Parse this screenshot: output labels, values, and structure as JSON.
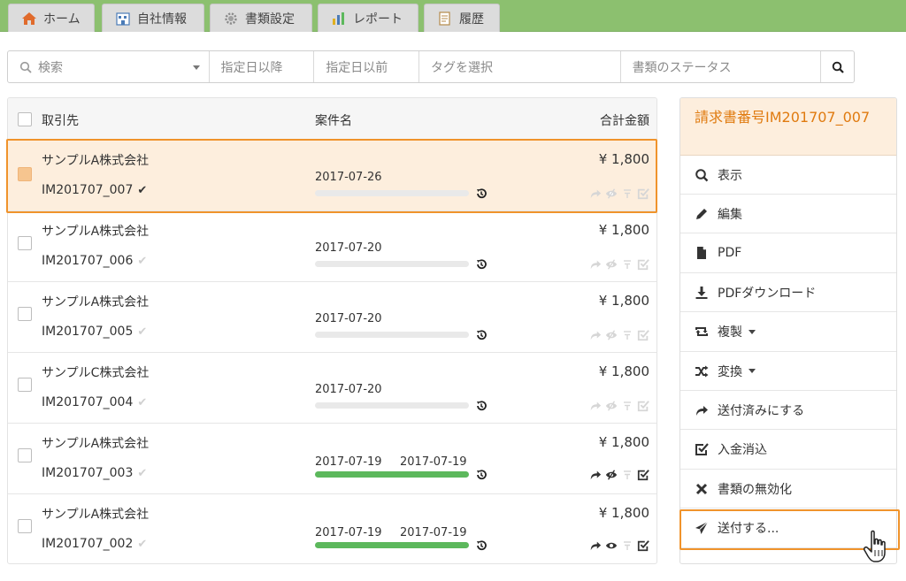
{
  "nav": {
    "tabs": [
      {
        "label": "ホーム",
        "icon": "home-icon"
      },
      {
        "label": "自社情報",
        "icon": "building-icon"
      },
      {
        "label": "書類設定",
        "icon": "gear-icon"
      },
      {
        "label": "レポート",
        "icon": "bar-chart-icon"
      },
      {
        "label": "履歴",
        "icon": "history-doc-icon"
      }
    ]
  },
  "search": {
    "keyword_placeholder": "検索",
    "date_from_placeholder": "指定日以降",
    "date_to_placeholder": "指定日以前",
    "tag_placeholder": "タグを選択",
    "status_placeholder": "書類のステータス"
  },
  "table": {
    "headers": {
      "client": "取引先",
      "subject": "案件名",
      "total": "合計金額"
    },
    "rows": [
      {
        "client": "サンプルA株式会社",
        "doc_no": "IM201707_007",
        "date1": "2017-07-26",
        "date2": "",
        "progress": 0,
        "amount": "¥ 1,800",
        "sent": false,
        "viewed": false,
        "paid": false,
        "selected": true,
        "confirmed": true
      },
      {
        "client": "サンプルA株式会社",
        "doc_no": "IM201707_006",
        "date1": "2017-07-20",
        "date2": "",
        "progress": 0,
        "amount": "¥ 1,800",
        "sent": false,
        "viewed": false,
        "paid": false,
        "selected": false,
        "confirmed": false
      },
      {
        "client": "サンプルA株式会社",
        "doc_no": "IM201707_005",
        "date1": "2017-07-20",
        "date2": "",
        "progress": 0,
        "amount": "¥ 1,800",
        "sent": false,
        "viewed": false,
        "paid": false,
        "selected": false,
        "confirmed": false
      },
      {
        "client": "サンプルC株式会社",
        "doc_no": "IM201707_004",
        "date1": "2017-07-20",
        "date2": "",
        "progress": 0,
        "amount": "¥ 1,800",
        "sent": false,
        "viewed": false,
        "paid": false,
        "selected": false,
        "confirmed": false
      },
      {
        "client": "サンプルA株式会社",
        "doc_no": "IM201707_003",
        "date1": "2017-07-19",
        "date2": "2017-07-19",
        "progress": 1,
        "amount": "¥ 1,800",
        "sent": true,
        "viewed": true,
        "paid": true,
        "selected": false,
        "confirmed": false
      },
      {
        "client": "サンプルA株式会社",
        "doc_no": "IM201707_002",
        "date1": "2017-07-19",
        "date2": "2017-07-19",
        "progress": 1,
        "amount": "¥ 1,800",
        "sent": true,
        "viewed": true,
        "paid": true,
        "selected": false,
        "confirmed": false
      }
    ]
  },
  "panel": {
    "title": "請求書番号IM201707_007",
    "items": [
      {
        "label": "表示",
        "icon": "search-icon",
        "dropdown": false
      },
      {
        "label": "編集",
        "icon": "pencil-icon",
        "dropdown": false
      },
      {
        "label": "PDF",
        "icon": "file-icon",
        "dropdown": false
      },
      {
        "label": "PDFダウンロード",
        "icon": "download-icon",
        "dropdown": false
      },
      {
        "label": "複製",
        "icon": "retweet-icon",
        "dropdown": true
      },
      {
        "label": "変換",
        "icon": "shuffle-icon",
        "dropdown": true
      },
      {
        "label": "送付済みにする",
        "icon": "share-arrow-icon",
        "dropdown": false
      },
      {
        "label": "入金消込",
        "icon": "check-square-icon",
        "dropdown": false
      },
      {
        "label": "書類の無効化",
        "icon": "x-icon",
        "dropdown": false
      },
      {
        "label": "送付する...",
        "icon": "paper-plane-icon",
        "dropdown": false
      }
    ]
  },
  "colors": {
    "nav_green": "#8cc06f",
    "highlight_orange": "#f0932b",
    "selected_row_bg": "#fdeedd",
    "panel_title": "#e07b10",
    "progress_green": "#5cb85c"
  }
}
